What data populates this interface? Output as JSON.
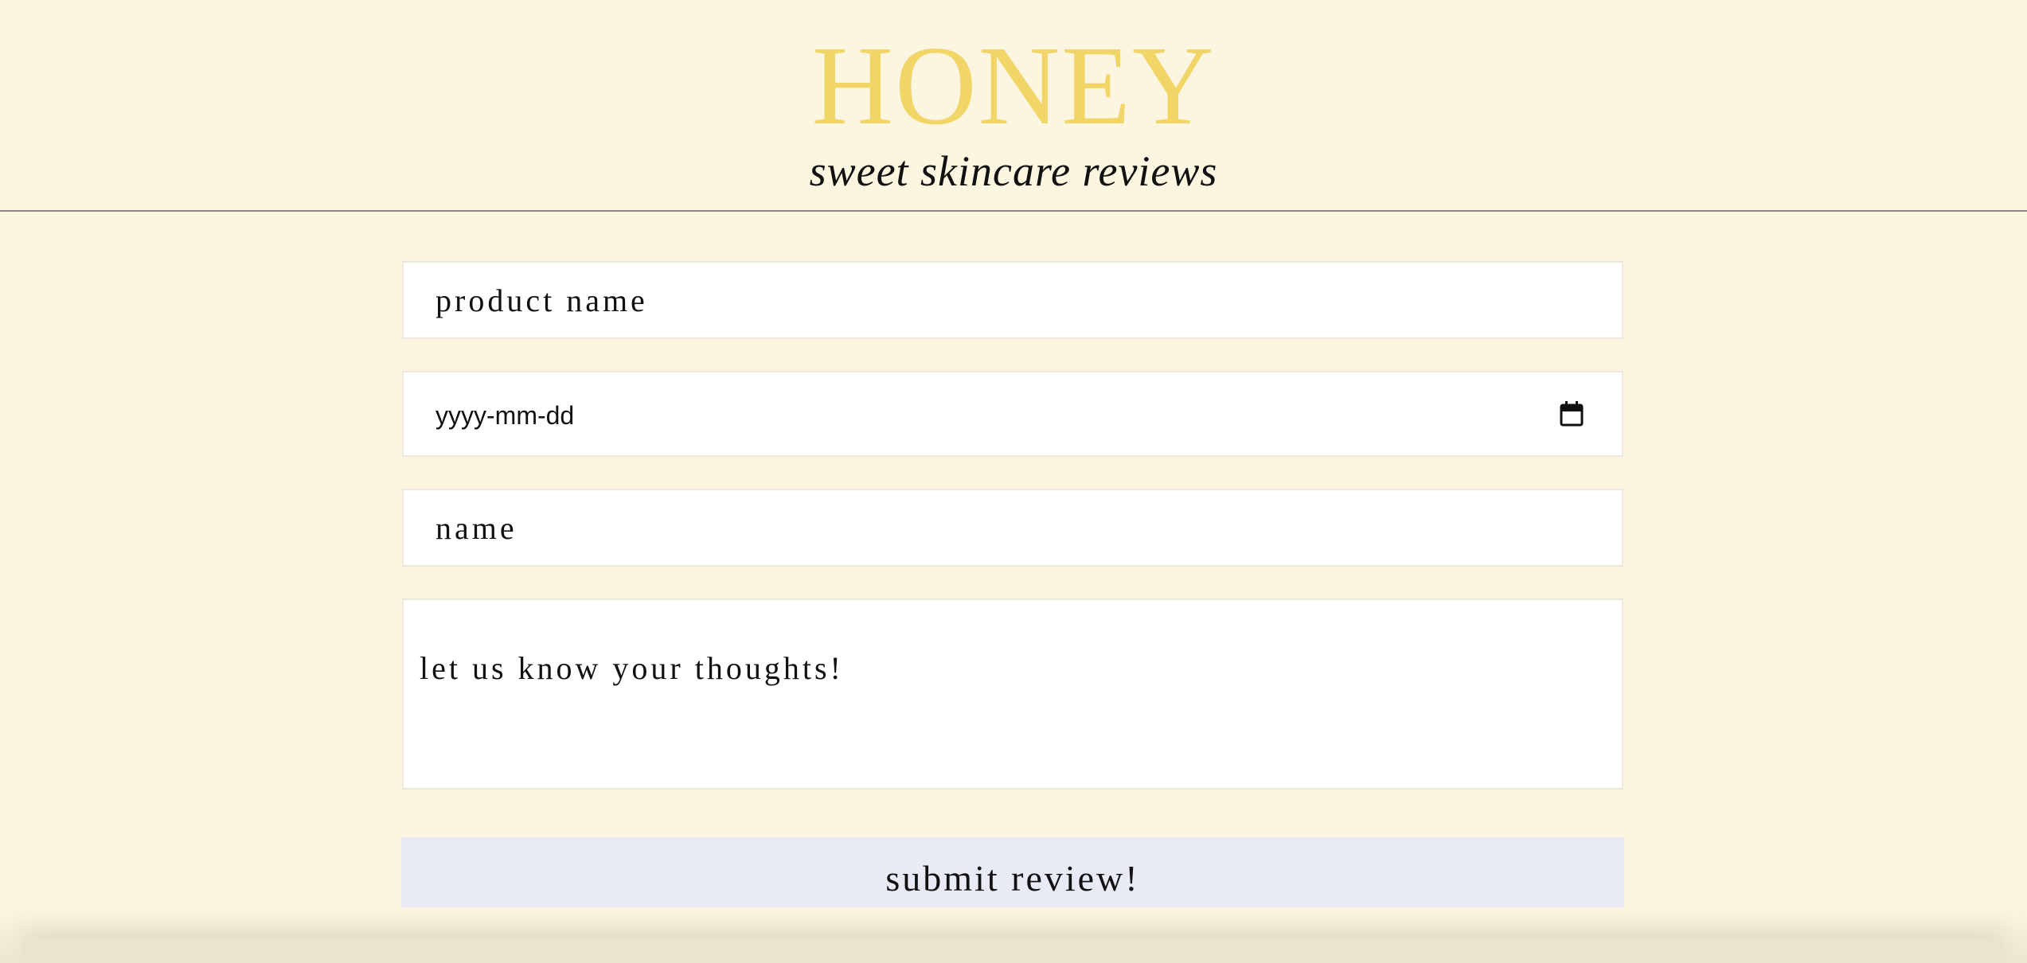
{
  "header": {
    "brand": "HONEY",
    "tagline": "sweet skincare reviews"
  },
  "form": {
    "product_placeholder": "product name",
    "date_placeholder": "yyyy-mm-dd",
    "name_placeholder": "name",
    "thoughts_placeholder": "let us know your thoughts!",
    "submit_label": "submit review!"
  },
  "icons": {
    "date_picker": "calendar-icon"
  },
  "colors": {
    "background": "#fcf5df",
    "brand": "#f2d567",
    "button": "#e8ebf6"
  }
}
